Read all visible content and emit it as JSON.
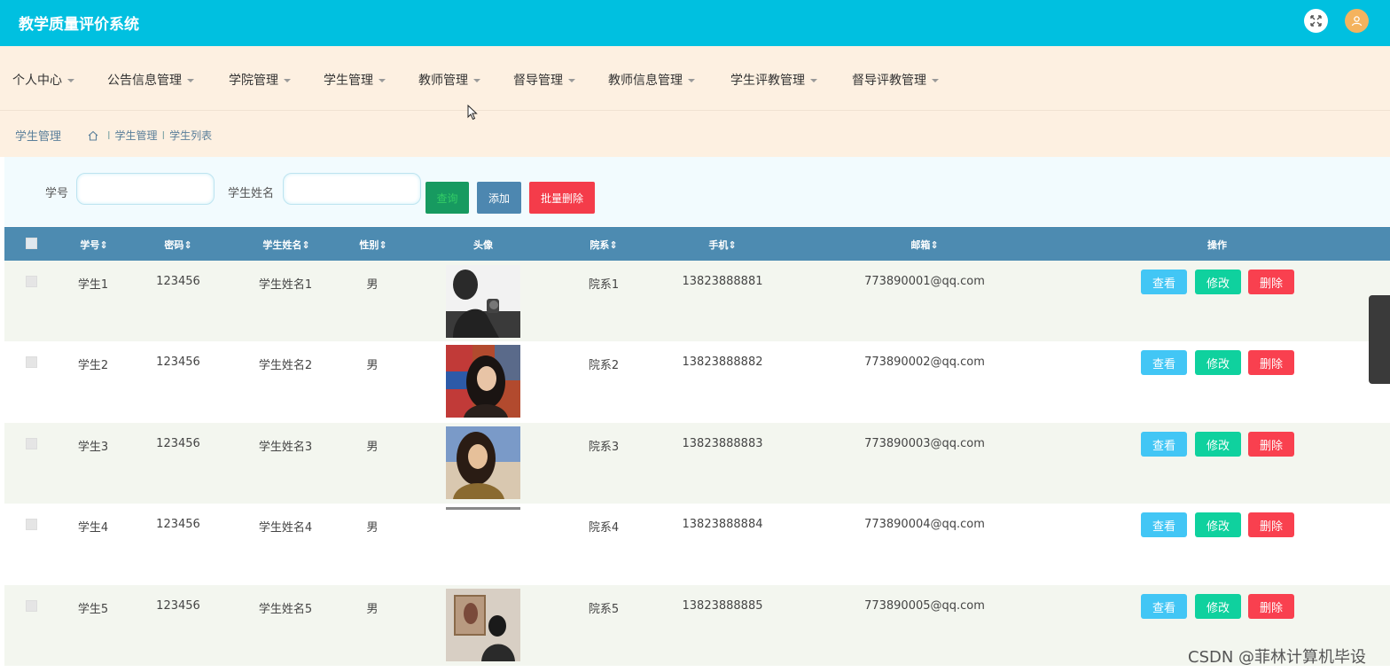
{
  "app": {
    "title": "教学质量评价系统"
  },
  "nav": [
    {
      "label": "个人中心"
    },
    {
      "label": "公告信息管理"
    },
    {
      "label": "学院管理"
    },
    {
      "label": "学生管理"
    },
    {
      "label": "教师管理"
    },
    {
      "label": "督导管理"
    },
    {
      "label": "教师信息管理"
    },
    {
      "label": "学生评教管理"
    },
    {
      "label": "督导评教管理"
    }
  ],
  "breadcrumb": {
    "title": "学生管理",
    "items": [
      "学生管理",
      "学生列表"
    ],
    "separator": "I"
  },
  "search": {
    "id_label": "学号",
    "id_value": "",
    "name_label": "学生姓名",
    "name_value": "",
    "query_label": "查询",
    "add_label": "添加",
    "batch_delete_label": "批量删除"
  },
  "table": {
    "headers": {
      "id": "学号",
      "password": "密码",
      "name": "学生姓名",
      "gender": "性别",
      "avatar": "头像",
      "dept": "院系",
      "phone": "手机",
      "email": "邮箱",
      "actions": "操作"
    },
    "sortable_mark": "⇕",
    "rows": [
      {
        "id": "学生1",
        "password": "123456",
        "name": "学生姓名1",
        "gender": "男",
        "dept": "院系1",
        "phone": "13823888881",
        "email": "773890001@qq.com"
      },
      {
        "id": "学生2",
        "password": "123456",
        "name": "学生姓名2",
        "gender": "男",
        "dept": "院系2",
        "phone": "13823888882",
        "email": "773890002@qq.com"
      },
      {
        "id": "学生3",
        "password": "123456",
        "name": "学生姓名3",
        "gender": "男",
        "dept": "院系3",
        "phone": "13823888883",
        "email": "773890003@qq.com"
      },
      {
        "id": "学生4",
        "password": "123456",
        "name": "学生姓名4",
        "gender": "男",
        "dept": "院系4",
        "phone": "13823888884",
        "email": "773890004@qq.com"
      },
      {
        "id": "学生5",
        "password": "123456",
        "name": "学生姓名5",
        "gender": "男",
        "dept": "院系5",
        "phone": "13823888885",
        "email": "773890005@qq.com"
      }
    ],
    "actions": {
      "view": "查看",
      "edit": "修改",
      "delete": "删除"
    }
  },
  "watermark": "CSDN @菲林计算机毕设",
  "colors": {
    "topbar": "#00c0e0",
    "nav_bg": "#fdf0e1",
    "table_head": "#4d8bb1",
    "view": "#42c6f5",
    "edit": "#0fd19e",
    "delete": "#f9404f"
  }
}
